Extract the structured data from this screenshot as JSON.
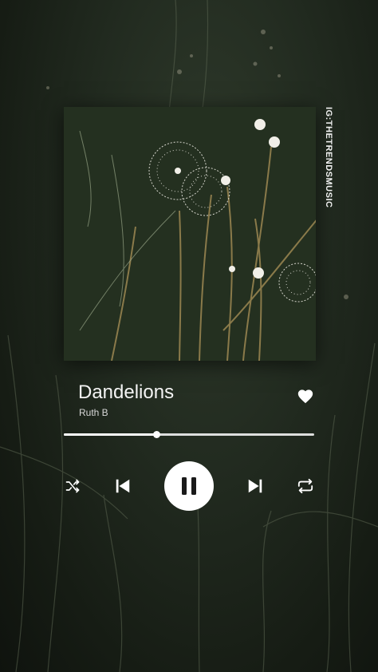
{
  "track": {
    "title": "Dandelions",
    "artist": "Ruth B",
    "progress_fraction": 0.37
  },
  "watermark": "IG:THETRENDSMUSIC",
  "controls": {
    "shuffle_icon": "shuffle-icon",
    "previous_icon": "skip-previous-icon",
    "pause_icon": "pause-icon",
    "next_icon": "skip-next-icon",
    "repeat_icon": "repeat-icon",
    "like_icon": "heart-icon"
  },
  "colors": {
    "text": "#f4f4f4",
    "accent": "#ffffff",
    "background": "#1b2219"
  }
}
